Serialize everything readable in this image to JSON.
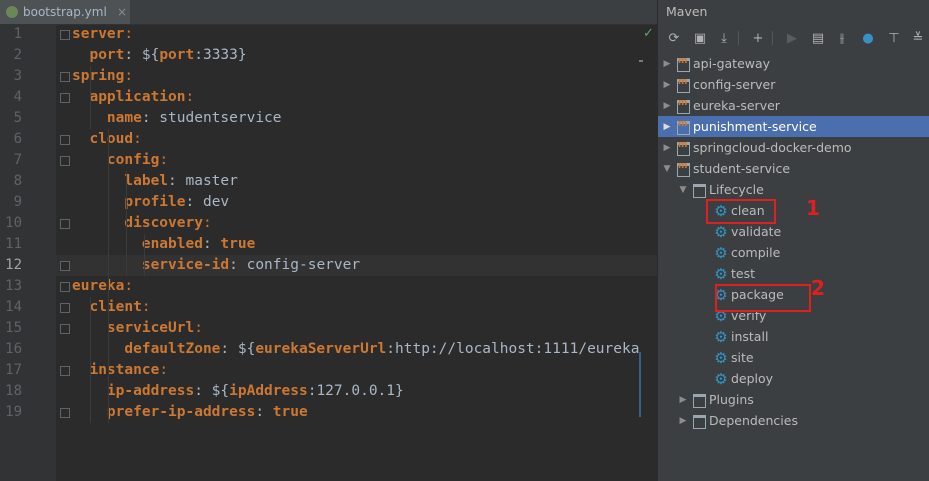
{
  "editor": {
    "tab_label": "bootstrap.yml",
    "tab_close": "×",
    "lines": [
      {
        "num": "1",
        "parts": [
          {
            "t": "server",
            "c": "k"
          },
          {
            "t": ":",
            "c": "c"
          }
        ]
      },
      {
        "num": "2",
        "parts": [
          {
            "t": "  port",
            "c": "k"
          },
          {
            "t": ": ${",
            "c": "v"
          },
          {
            "t": "port",
            "c": "pk"
          },
          {
            "t": ":3333}",
            "c": "v"
          }
        ]
      },
      {
        "num": "3",
        "parts": [
          {
            "t": "spring",
            "c": "k"
          },
          {
            "t": ":",
            "c": "c"
          }
        ]
      },
      {
        "num": "4",
        "parts": [
          {
            "t": "  application",
            "c": "k"
          },
          {
            "t": ":",
            "c": "c"
          }
        ]
      },
      {
        "num": "5",
        "parts": [
          {
            "t": "    name",
            "c": "k"
          },
          {
            "t": ": studentservice",
            "c": "v"
          }
        ]
      },
      {
        "num": "6",
        "parts": [
          {
            "t": "  cloud",
            "c": "k"
          },
          {
            "t": ":",
            "c": "c"
          }
        ]
      },
      {
        "num": "7",
        "parts": [
          {
            "t": "    config",
            "c": "k"
          },
          {
            "t": ":",
            "c": "c"
          }
        ]
      },
      {
        "num": "8",
        "parts": [
          {
            "t": "      label",
            "c": "k"
          },
          {
            "t": ": master",
            "c": "v"
          }
        ]
      },
      {
        "num": "9",
        "parts": [
          {
            "t": "      profile",
            "c": "k"
          },
          {
            "t": ": dev",
            "c": "v"
          }
        ]
      },
      {
        "num": "10",
        "parts": [
          {
            "t": "      discovery",
            "c": "k"
          },
          {
            "t": ":",
            "c": "c"
          }
        ]
      },
      {
        "num": "11",
        "parts": [
          {
            "t": "        enabled",
            "c": "k"
          },
          {
            "t": ": ",
            "c": "v"
          },
          {
            "t": "true",
            "c": "b"
          }
        ]
      },
      {
        "num": "12",
        "parts": [
          {
            "t": "        service-id",
            "c": "k"
          },
          {
            "t": ": config-server",
            "c": "v"
          }
        ]
      },
      {
        "num": "13",
        "parts": [
          {
            "t": "eureka",
            "c": "k"
          },
          {
            "t": ":",
            "c": "c"
          }
        ]
      },
      {
        "num": "14",
        "parts": [
          {
            "t": "  client",
            "c": "k"
          },
          {
            "t": ":",
            "c": "c"
          }
        ]
      },
      {
        "num": "15",
        "parts": [
          {
            "t": "    serviceUrl",
            "c": "k"
          },
          {
            "t": ":",
            "c": "c"
          }
        ]
      },
      {
        "num": "16",
        "parts": [
          {
            "t": "      defaultZone",
            "c": "k"
          },
          {
            "t": ": ${",
            "c": "v"
          },
          {
            "t": "eurekaServerUrl",
            "c": "pk"
          },
          {
            "t": ":http://localhost:1111/eureka",
            "c": "v"
          }
        ]
      },
      {
        "num": "17",
        "parts": [
          {
            "t": "  instance",
            "c": "k"
          },
          {
            "t": ":",
            "c": "c"
          }
        ]
      },
      {
        "num": "18",
        "parts": [
          {
            "t": "    ip-address",
            "c": "k"
          },
          {
            "t": ": ${",
            "c": "v"
          },
          {
            "t": "ipAddress",
            "c": "pk"
          },
          {
            "t": ":127.0.0.1}",
            "c": "v"
          }
        ]
      },
      {
        "num": "19",
        "parts": [
          {
            "t": "    prefer-ip-address",
            "c": "k"
          },
          {
            "t": ": ",
            "c": "v"
          },
          {
            "t": "true",
            "c": "b"
          }
        ]
      }
    ],
    "current_line": "12",
    "status_icon": "✓"
  },
  "maven": {
    "title": "Maven",
    "toolbar": [
      {
        "name": "refresh-icon",
        "glyph": "⟳"
      },
      {
        "name": "reimport-icon",
        "glyph": "▣"
      },
      {
        "name": "download-icon",
        "glyph": "⤓"
      },
      {
        "name": "add-icon",
        "glyph": "+"
      },
      {
        "name": "run-icon",
        "glyph": "▶"
      },
      {
        "name": "execute-goal-icon",
        "glyph": "▤"
      },
      {
        "name": "toggle-offline-icon",
        "glyph": "⫲"
      },
      {
        "name": "skip-tests-icon",
        "glyph": "●"
      },
      {
        "name": "collapse-all-icon",
        "glyph": "⊤"
      },
      {
        "name": "settings-icon",
        "glyph": "≚"
      }
    ],
    "projects": [
      {
        "label": "api-gateway",
        "expanded": false,
        "selected": false
      },
      {
        "label": "config-server",
        "expanded": false,
        "selected": false
      },
      {
        "label": "eureka-server",
        "expanded": false,
        "selected": false
      },
      {
        "label": "punishment-service",
        "expanded": false,
        "selected": true
      },
      {
        "label": "springcloud-docker-demo",
        "expanded": false,
        "selected": false
      },
      {
        "label": "student-service",
        "expanded": true,
        "selected": false
      }
    ],
    "lifecycle_label": "Lifecycle",
    "goals": [
      "clean",
      "validate",
      "compile",
      "test",
      "package",
      "verify",
      "install",
      "site",
      "deploy"
    ],
    "plugins_label": "Plugins",
    "dependencies_label": "Dependencies"
  },
  "annotations": {
    "mark_1": "1",
    "mark_2": "2"
  },
  "colors": {
    "accent_selection": "#4b6eaf",
    "annotation_red": "#e02020",
    "yaml_key": "#cc7832",
    "goal_icon": "#3592c4"
  }
}
